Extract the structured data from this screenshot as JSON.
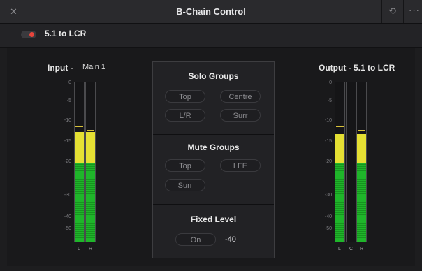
{
  "window": {
    "title": "B-Chain Control",
    "close_icon": "close-icon",
    "reset_icon": "reset-history-icon",
    "more_icon": "more-options-icon"
  },
  "preset": {
    "label": "5.1 to LCR",
    "enabled": true,
    "accent": "#e8453c"
  },
  "input": {
    "header": "Input -",
    "bus": "Main 1",
    "scale": [
      "0",
      "-5",
      "-10",
      "-15",
      "-20",
      "-30",
      "-40",
      "-50"
    ],
    "channels": [
      {
        "label": "L",
        "level_db": -12.5,
        "peak_db": -11
      },
      {
        "label": "R",
        "level_db": -12.5,
        "peak_db": -12
      }
    ]
  },
  "output": {
    "header": "Output - 5.1 to LCR",
    "scale": [
      "0",
      "-5",
      "-10",
      "-15",
      "-20",
      "-30",
      "-40",
      "-50"
    ],
    "channels": [
      {
        "label": "L",
        "level_db": -13,
        "peak_db": -11
      },
      {
        "label": "C",
        "level_db": null,
        "peak_db": null
      },
      {
        "label": "R",
        "level_db": -13,
        "peak_db": -12
      }
    ]
  },
  "solo_groups": {
    "title": "Solo Groups",
    "buttons": [
      "Top",
      "Centre",
      "L/R",
      "Surr"
    ]
  },
  "mute_groups": {
    "title": "Mute Groups",
    "buttons": [
      "Top",
      "LFE",
      "Surr"
    ]
  },
  "fixed_level": {
    "title": "Fixed Level",
    "button": "On",
    "value": "-40"
  },
  "colors": {
    "meter_green": "#1fb52a",
    "meter_yellow": "#e5e033",
    "peak_marker": "#d8c23a"
  }
}
